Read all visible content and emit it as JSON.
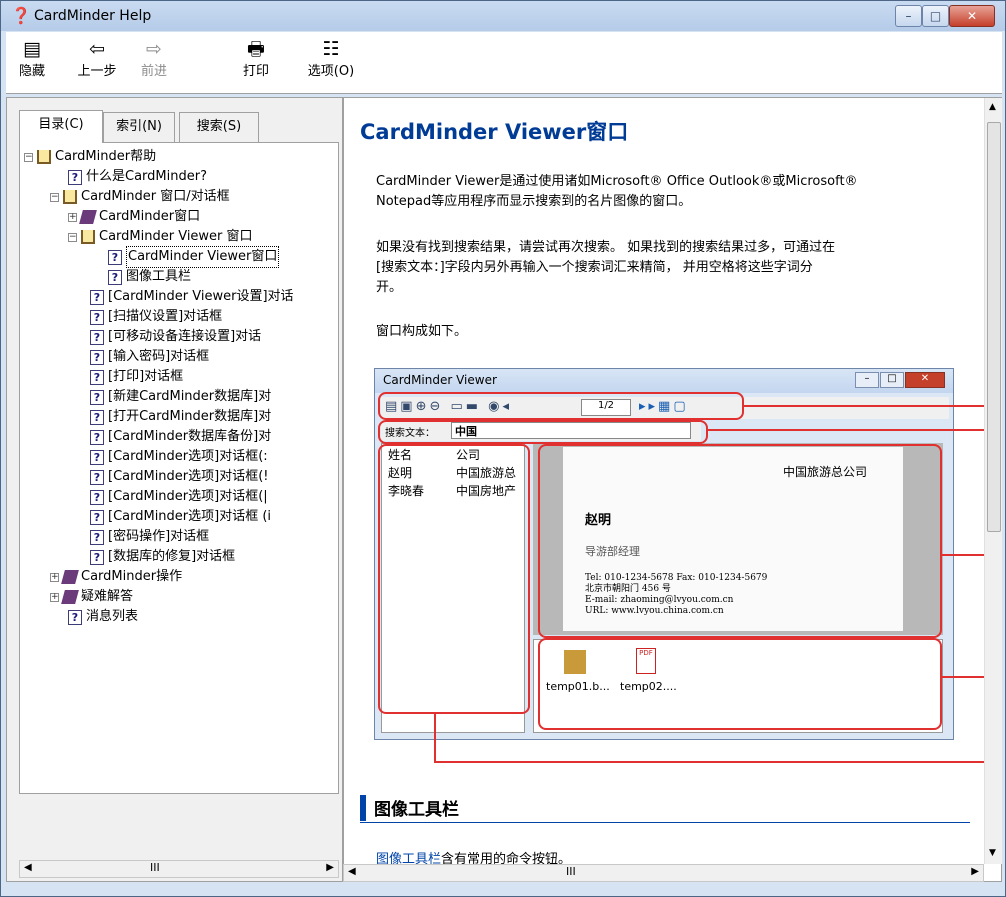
{
  "window": {
    "title": "CardMinder Help"
  },
  "toolbar": {
    "hide": "隐藏",
    "back": "上一步",
    "forward": "前进",
    "print": "打印",
    "options": "选项(O)"
  },
  "tabs": [
    "目录(C)",
    "索引(N)",
    "搜索(S)"
  ],
  "tree": [
    {
      "label": "CardMinder帮助"
    },
    {
      "label": "什么是CardMinder?"
    },
    {
      "label": "CardMinder 窗口/对话框"
    },
    {
      "label": "CardMinder窗口"
    },
    {
      "label": "CardMinder Viewer 窗口"
    },
    {
      "label": "CardMinder Viewer窗口"
    },
    {
      "label": "图像工具栏"
    },
    {
      "label": "[CardMinder Viewer设置]对话"
    },
    {
      "label": "[扫描仪设置]对话框"
    },
    {
      "label": "[可移动设备连接设置]对话"
    },
    {
      "label": "[输入密码]对话框"
    },
    {
      "label": "[打印]对话框"
    },
    {
      "label": "[新建CardMinder数据库]对"
    },
    {
      "label": "[打开CardMinder数据库]对"
    },
    {
      "label": "[CardMinder数据库备份]对"
    },
    {
      "label": "[CardMinder选项]对话框(:"
    },
    {
      "label": "[CardMinder选项]对话框(!"
    },
    {
      "label": "[CardMinder选项]对话框(|"
    },
    {
      "label": "[CardMinder选项]对话框 (i"
    },
    {
      "label": "[密码操作]对话框"
    },
    {
      "label": "[数据库的修复]对话框"
    },
    {
      "label": "CardMinder操作"
    },
    {
      "label": "疑难解答"
    },
    {
      "label": "消息列表"
    }
  ],
  "content": {
    "title": "CardMinder Viewer窗口",
    "p1a": "CardMinder Viewer是通过使用诸如Microsoft® Office Outlook®或Microsoft®",
    "p1b": "Notepad等应用程序而显示搜索到的名片图像的窗口。",
    "p2a": "如果没有找到搜索结果，请尝试再次搜索。 如果找到的搜索结果过多，可通过在",
    "p2b": "[搜索文本：]字段内另外再输入一个搜索词汇来精简， 并用空格将这些字词分",
    "p2c": "开。",
    "p3": "窗口构成如下。",
    "section": "图像工具栏",
    "p4_link": "图像工具栏",
    "p4_rest": "含有常用的命令按钮。"
  },
  "viewer": {
    "title": "CardMinder Viewer",
    "page": "1/2",
    "search_label": "搜索文本：",
    "search_value": "中国",
    "col_name": "姓名",
    "col_company": "公司",
    "rows": [
      {
        "name": "赵明",
        "company": "中国旅游总"
      },
      {
        "name": "李晓春",
        "company": "中国房地产"
      }
    ],
    "card_company": "中国旅游总公司",
    "card_name": "赵明",
    "card_title": "导游部经理",
    "card_l1": "Tel: 010-1234-5678  Fax: 010-1234-5679",
    "card_l2": "北京市朝阳门 456 号",
    "card_l3": "E-mail: zhaoming@lvyou.com.cn",
    "card_l4": "URL: www.lvyou.china.com.cn",
    "file1": "temp01.b...",
    "file2": "temp02...."
  },
  "scroll": {
    "h": "III"
  }
}
